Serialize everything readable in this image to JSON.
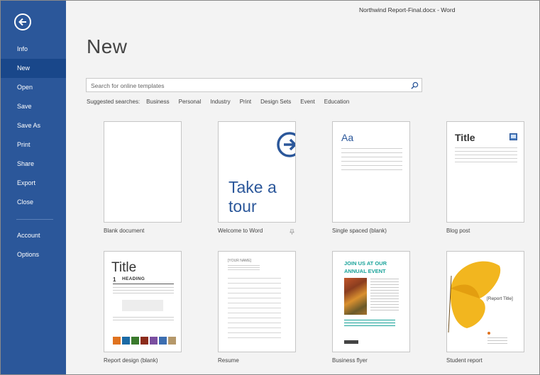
{
  "window": {
    "title": "Northwind Report-Final.docx - Word"
  },
  "sidebar": {
    "items": [
      {
        "label": "Info"
      },
      {
        "label": "New"
      },
      {
        "label": "Open"
      },
      {
        "label": "Save"
      },
      {
        "label": "Save As"
      },
      {
        "label": "Print"
      },
      {
        "label": "Share"
      },
      {
        "label": "Export"
      },
      {
        "label": "Close"
      },
      {
        "label": "Account"
      },
      {
        "label": "Options"
      }
    ],
    "active": "New"
  },
  "main": {
    "title": "New",
    "search": {
      "placeholder": "Search for online templates"
    },
    "suggested": {
      "label": "Suggested searches:",
      "links": [
        "Business",
        "Personal",
        "Industry",
        "Print",
        "Design Sets",
        "Event",
        "Education"
      ]
    },
    "templates": [
      {
        "caption": "Blank document"
      },
      {
        "caption": "Welcome to Word",
        "text": "Take a tour"
      },
      {
        "caption": "Single spaced (blank)",
        "text": "Aa"
      },
      {
        "caption": "Blog post",
        "text": "Title"
      },
      {
        "caption": "Report design (blank)",
        "text": "Title",
        "num": "1",
        "heading": "Heading"
      },
      {
        "caption": "Resume",
        "name": "[YOUR NAME]"
      },
      {
        "caption": "Business flyer",
        "headline": "JOIN US AT OUR ANNUAL EVENT"
      },
      {
        "caption": "Student report",
        "doc_title": "[Report Title]"
      }
    ]
  },
  "colors": {
    "sidebar": "#2b579a",
    "sidebar_active": "#19478a",
    "accent": "#2b579a",
    "flyer_teal": "#1aa39a",
    "swatches": [
      "#e0731f",
      "#1b6aa5",
      "#3a7a2d",
      "#8c2c1c",
      "#7b4fa0",
      "#3d6eb0",
      "#b5986a"
    ]
  },
  "icons": {
    "back": "arrow-left-circle-icon",
    "search": "search-icon",
    "pin": "pin-icon",
    "tour": "arrow-right-circle-icon",
    "blog": "image-icon"
  }
}
